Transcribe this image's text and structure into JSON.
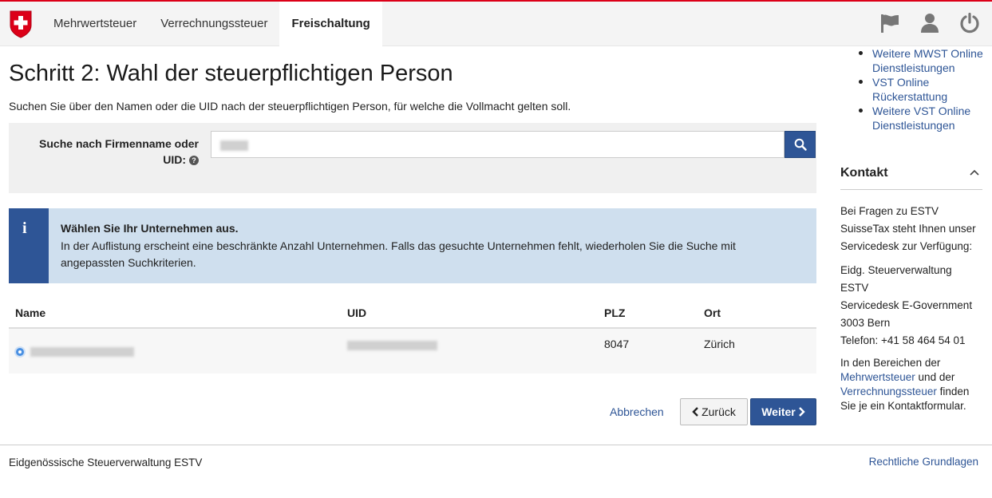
{
  "header": {
    "nav": [
      {
        "label": "Mehrwertsteuer"
      },
      {
        "label": "Verrechnungssteuer"
      },
      {
        "label": "Freischaltung"
      }
    ]
  },
  "icons": {
    "logo": "swiss-cross-logo",
    "flag": "flag-icon",
    "user": "user-icon",
    "power": "power-icon",
    "search": "search-icon",
    "help": "help-icon",
    "info": "info-icon"
  },
  "colors": {
    "brand_red": "#dc0018",
    "primary": "#2e5596",
    "info_bg": "#cfdfee"
  },
  "main": {
    "title": "Schritt 2: Wahl der steuerpflichtigen Person",
    "subtitle": "Suchen Sie über den Namen oder die UID nach der steuerpflichtigen Person, für welche die Vollmacht gelten soll.",
    "search": {
      "label_line1": "Suche nach Firmenname oder",
      "label_line2": "UID:",
      "help_glyph": "?"
    },
    "info": {
      "glyph": "i",
      "title": "Wählen Sie Ihr Unternehmen aus.",
      "text": "In der Auflistung erscheint eine beschränkte Anzahl Unternehmen. Falls das gesuchte Unternehmen fehlt, wiederholen Sie die Suche mit angepassten Suchkriterien."
    },
    "table": {
      "columns": [
        "Name",
        "UID",
        "PLZ",
        "Ort"
      ],
      "rows": [
        {
          "plz": "8047",
          "ort": "Zürich"
        }
      ]
    },
    "actions": {
      "cancel": "Abbrechen",
      "back": "Zurück",
      "next": "Weiter"
    }
  },
  "sidebar": {
    "links": [
      {
        "line1": "Weitere MWST Online",
        "line2": "Dienstleistungen"
      },
      {
        "line1": "VST Online",
        "line2": "Rückerstattung"
      },
      {
        "line1": "Weitere VST Online",
        "line2": "Dienstleistungen"
      }
    ],
    "kontakt": {
      "title": "Kontakt",
      "intro1": "Bei Fragen zu ESTV",
      "intro2": "SuisseTax steht Ihnen unser",
      "intro3": "Servicedesk zur Verfügung:",
      "addr1": "Eidg. Steuerverwaltung ESTV",
      "addr2": "Servicedesk E-Government",
      "addr3": "3003 Bern",
      "phone": "Telefon: +41 58 464 54 01",
      "text_a": "In den Bereichen der",
      "link_mwst": "Mehrwertsteuer",
      "text_b": " und der",
      "link_vst": "Verrechnungssteuer",
      "text_c": " finden",
      "text_d": "Sie je ein Kontaktformular."
    }
  },
  "footer": {
    "left": "Eidgenössische Steuerverwaltung ESTV",
    "right": "Rechtliche Grundlagen"
  }
}
